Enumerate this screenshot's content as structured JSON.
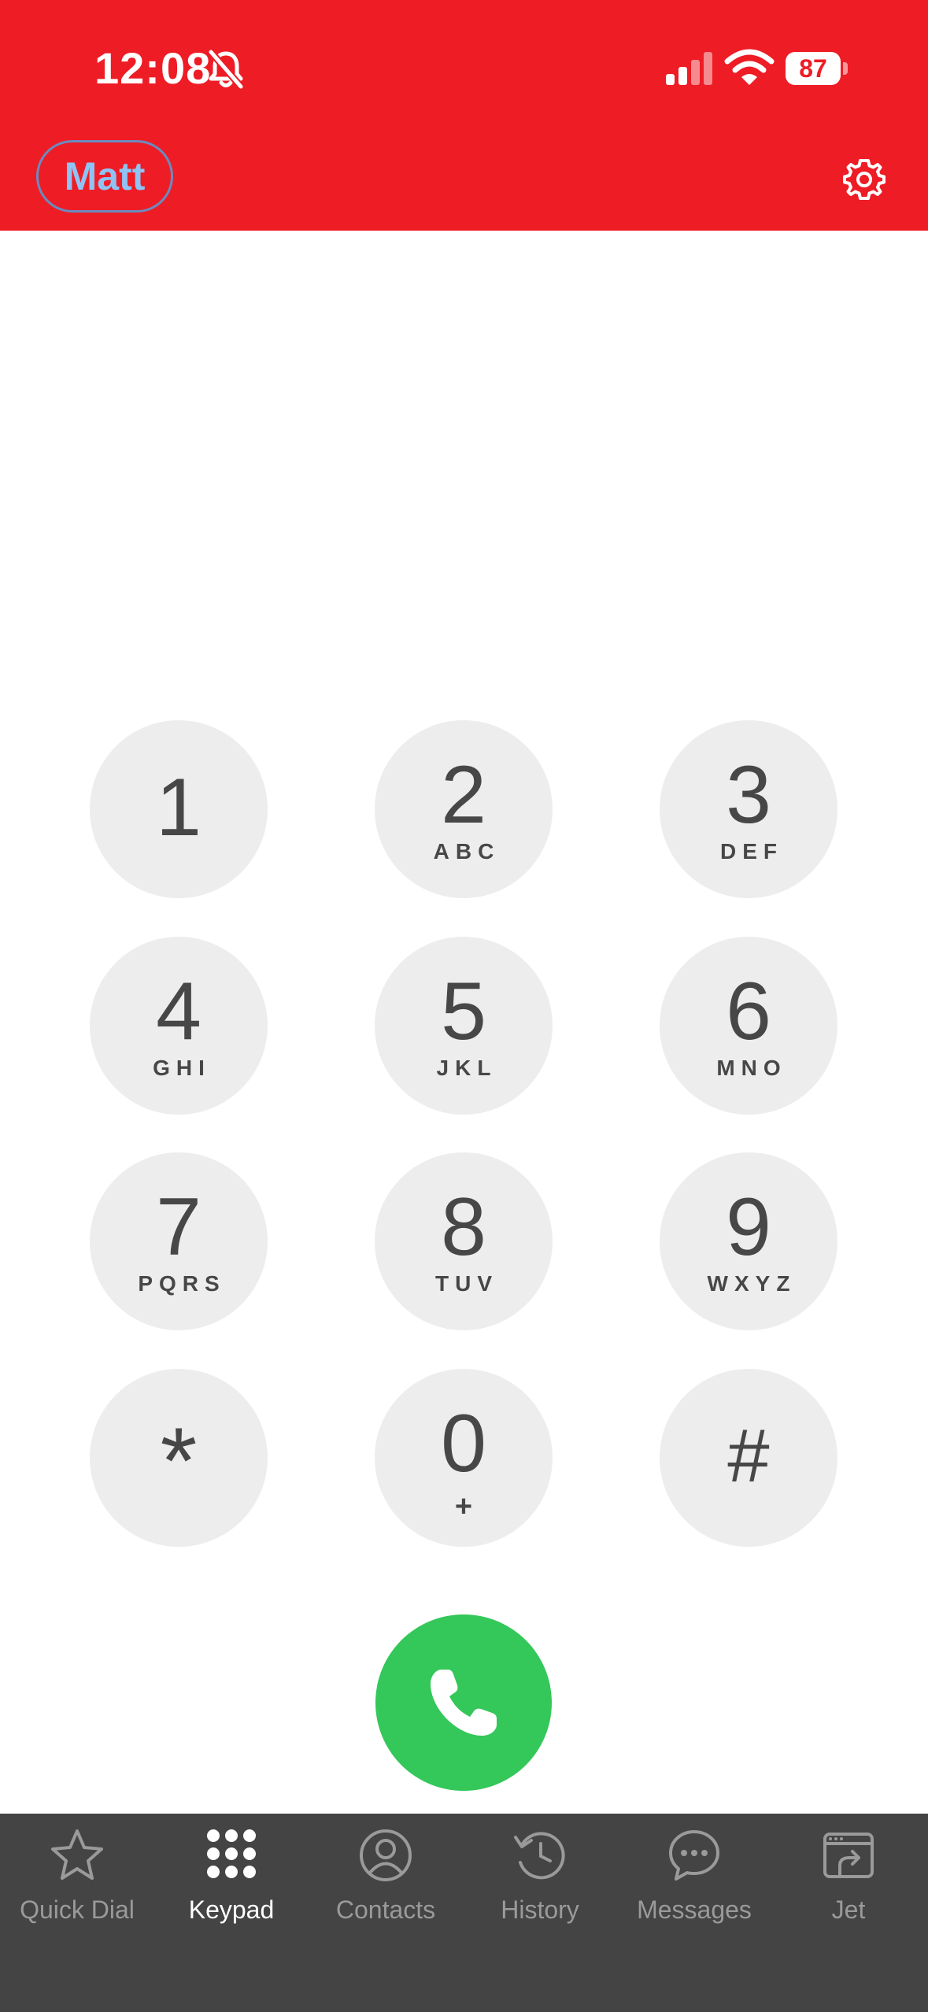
{
  "status_bar": {
    "time": "12:08",
    "battery": "87"
  },
  "header": {
    "user_name": "Matt"
  },
  "keypad": {
    "keys": [
      {
        "digit": "1",
        "letters": ""
      },
      {
        "digit": "2",
        "letters": "ABC"
      },
      {
        "digit": "3",
        "letters": "DEF"
      },
      {
        "digit": "4",
        "letters": "GHI"
      },
      {
        "digit": "5",
        "letters": "JKL"
      },
      {
        "digit": "6",
        "letters": "MNO"
      },
      {
        "digit": "7",
        "letters": "PQRS"
      },
      {
        "digit": "8",
        "letters": "TUV"
      },
      {
        "digit": "9",
        "letters": "WXYZ"
      },
      {
        "digit": "*",
        "letters": ""
      },
      {
        "digit": "0",
        "letters": "+"
      },
      {
        "digit": "#",
        "letters": ""
      }
    ]
  },
  "tabs": [
    {
      "label": "Quick Dial",
      "icon": "star-icon",
      "active": false
    },
    {
      "label": "Keypad",
      "icon": "keypad-grid-icon",
      "active": true
    },
    {
      "label": "Contacts",
      "icon": "person-circle-icon",
      "active": false
    },
    {
      "label": "History",
      "icon": "history-clock-icon",
      "active": false
    },
    {
      "label": "Messages",
      "icon": "chat-bubble-icon",
      "active": false
    },
    {
      "label": "Jet",
      "icon": "jet-window-icon",
      "active": false
    }
  ],
  "colors": {
    "header_red": "#ee1c25",
    "call_green": "#34c759",
    "tabbar_bg": "#444444",
    "key_bg": "#ededed",
    "user_pill_text": "#8ec3f4"
  }
}
